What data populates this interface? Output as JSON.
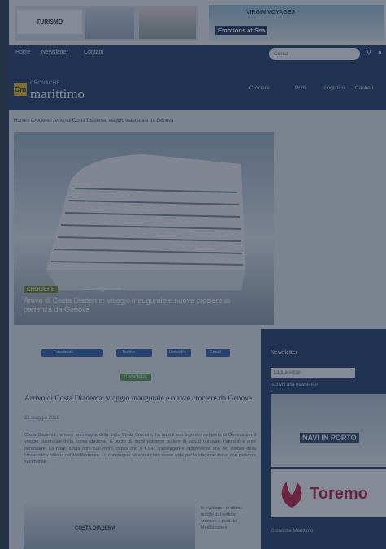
{
  "top_banner": {
    "ad_left_logo": "TURISMO",
    "ad_right_brand": "VIRGIN VOYAGES",
    "ad_right_cta": "Emotions at Sea"
  },
  "nav": {
    "links": [
      "Home",
      "Newsletter",
      "Contatti"
    ],
    "search_placeholder": "Cerca"
  },
  "header": {
    "brand_abbr": "Cm",
    "brand_small": "CRONACHE",
    "brand_name": "marittimo",
    "menu": [
      "Crociere",
      "Porti",
      "Logistica",
      "Cantieri"
    ]
  },
  "breadcrumb": "Home / Crociere / Arrivo di Costa Diadema, viaggio inaugurale da Genova",
  "hero": {
    "category": "CROCIERE",
    "date": "21 maggio 2019",
    "title": "Arrivo di Costa Diadema: viaggio inaugurale e nuove crociere in partenza da Genova"
  },
  "share": {
    "facebook": "Facebook",
    "twitter": "Twitter",
    "linkedin": "LinkedIn",
    "email": "Email"
  },
  "tag": "CROCIERE",
  "article": {
    "title": "Arrivo di Costa Diadema: viaggio inaugurale e nuove crociere da Genova",
    "date": "21 maggio 2019",
    "body": "Costa Diadema, la nave ammiraglia della flotta Costa Crociere, ha fatto il suo ingresso nel porto di Genova per il viaggio inaugurale della nuova stagione. A bordo gli ospiti potranno godere di servizi rinnovati, ristoranti e aree benessere. La nave, lunga oltre 300 metri, ospita fino a 4.947 passeggeri e rappresenta uno dei simboli della crocieristica italiana nel Mediterraneo. La compagnia ha annunciato nuove rotte per la stagione estiva con partenze settimanali.",
    "image_caption": "COSTA DIADEMA",
    "side_note": "In evidenza: le ultime notizie dal settore crociere e porti del Mediterraneo."
  },
  "sidebar": {
    "title": "Newsletter",
    "input_placeholder": "La tua email",
    "subtitle": "Iscriviti alla newsletter",
    "ad1_text": "NAVI IN PORTO",
    "ad2_text": "Toremo",
    "footer": "Cronache Marittimo"
  }
}
